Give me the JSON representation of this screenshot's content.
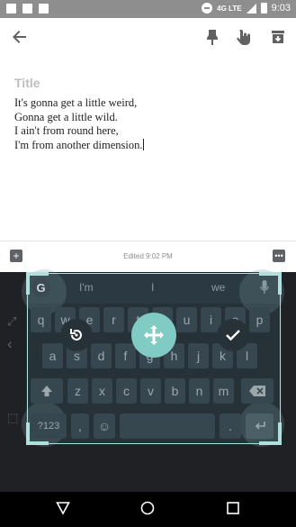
{
  "status_bar": {
    "time": "9:03",
    "network": "4G LTE"
  },
  "app_bar": {
    "back_icon": "arrow-left-icon",
    "pin_icon": "pin-icon",
    "reminder_icon": "hand-pointer-icon",
    "archive_icon": "archive-icon"
  },
  "note": {
    "title_placeholder": "Title",
    "body": "It's gonna get a little weird,\nGonna get a little wild.\nI ain't from round here,\nI'm from another dimension."
  },
  "note_bar": {
    "edited": "Edited 9:02 PM",
    "add_icon": "plus-box-icon",
    "more_icon": "more-dots-icon"
  },
  "keyboard": {
    "suggestions": [
      "I'm",
      "I",
      "we"
    ],
    "row1": [
      "q",
      "w",
      "e",
      "r",
      "t",
      "y",
      "u",
      "i",
      "o",
      "p"
    ],
    "row2": [
      "a",
      "s",
      "d",
      "f",
      "g",
      "h",
      "j",
      "k",
      "l"
    ],
    "row3": [
      "z",
      "x",
      "c",
      "v",
      "b",
      "n",
      "m"
    ],
    "symbols_label": "?123",
    "comma_label": ",",
    "period_label": ".",
    "emoji_icon": "emoji-icon",
    "shift_icon": "shift-icon",
    "backspace_icon": "backspace-icon",
    "enter_icon": "enter-icon",
    "mic_icon": "mic-icon",
    "google_icon": "google-g-icon",
    "reset_icon": "reset-icon",
    "move_icon": "move-arrows-icon",
    "done_icon": "check-icon"
  },
  "nav_bar": {
    "back": "triangle-back-icon",
    "home": "circle-home-icon",
    "recents": "square-recents-icon"
  },
  "colors": {
    "accent": "#80cbc4",
    "keyboard_bg": "#263238",
    "key": "#37474f",
    "frame": "#aee0de"
  }
}
